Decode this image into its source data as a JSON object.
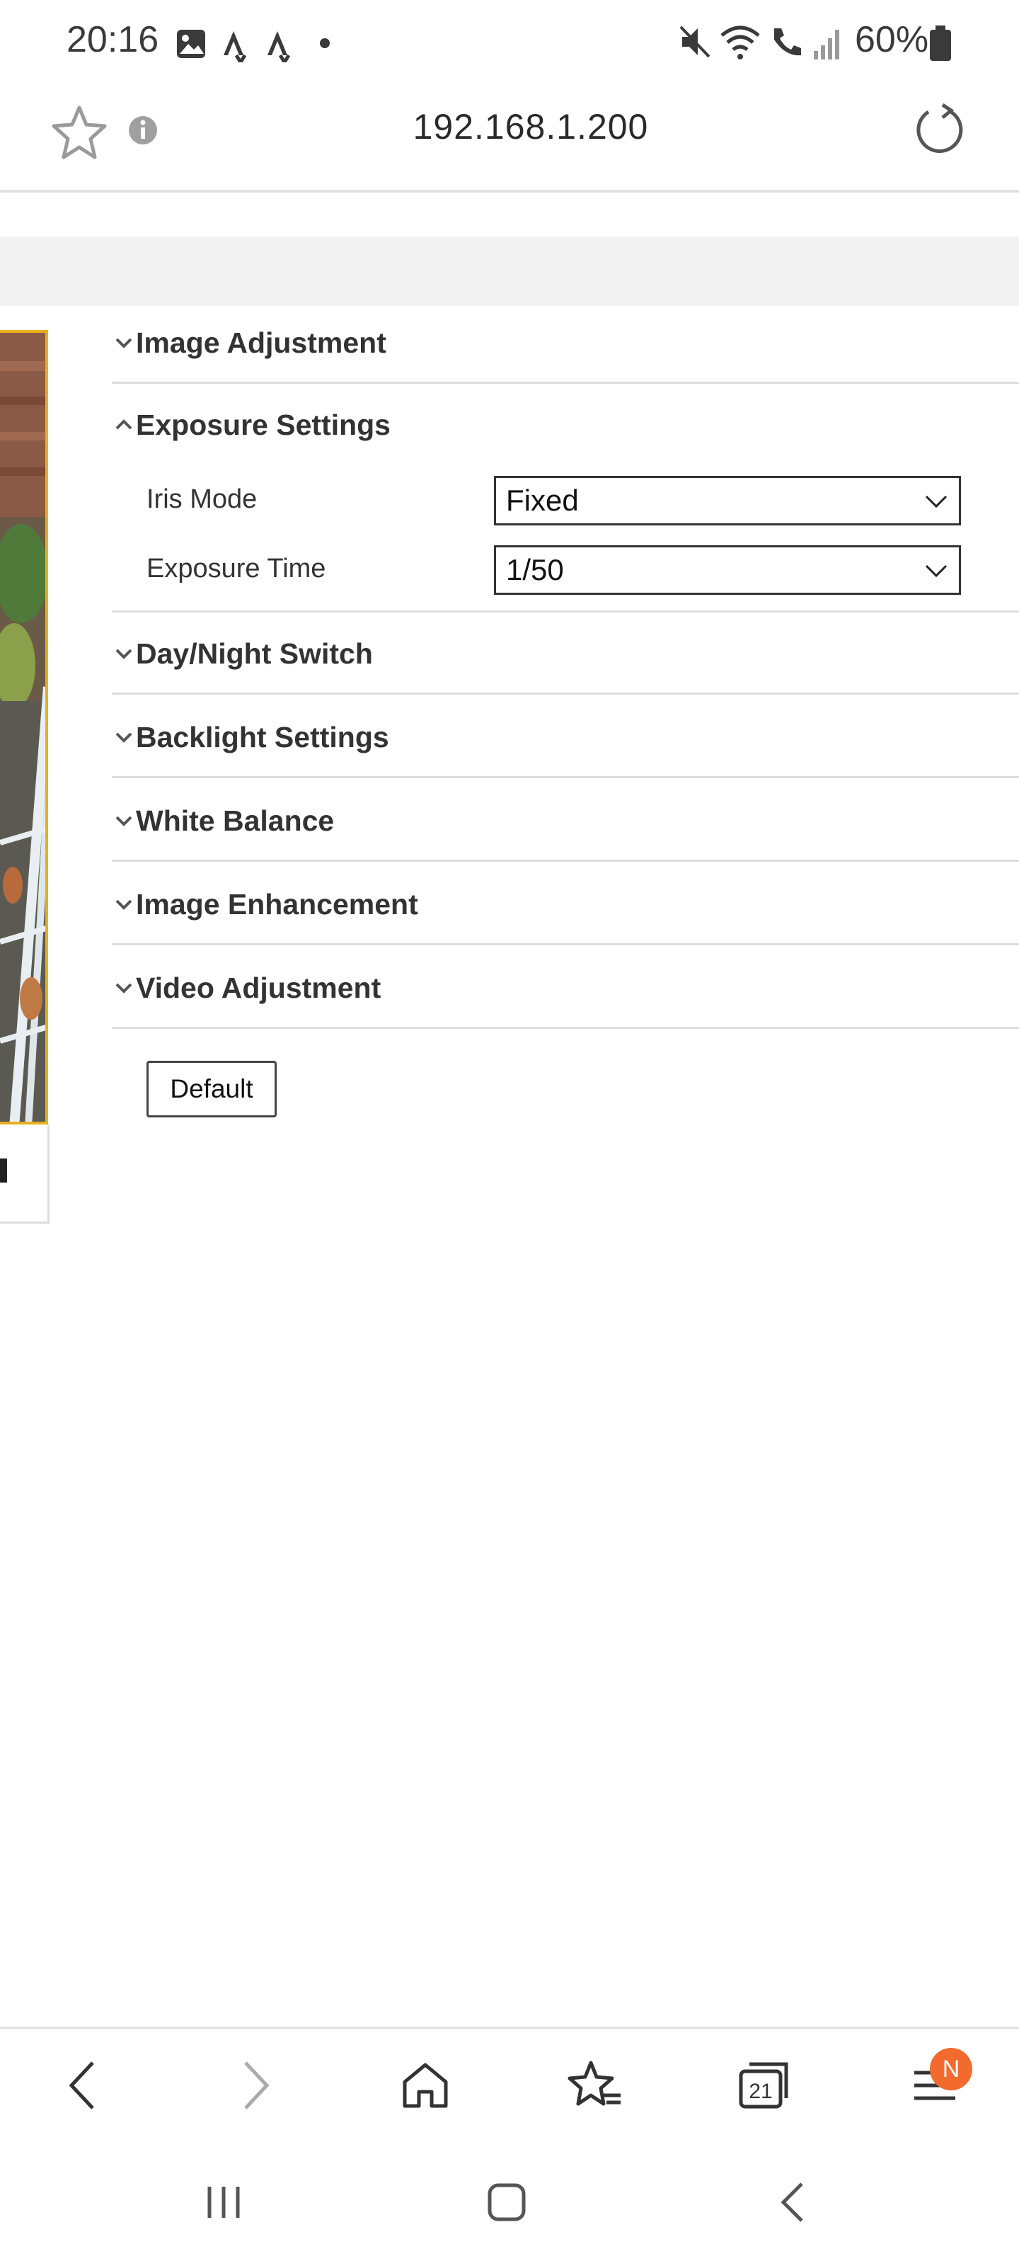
{
  "status_bar": {
    "time": "20:16",
    "battery": "60%",
    "left_icons": [
      "gallery-icon",
      "strava-icon",
      "strava-icon",
      "dot-icon"
    ],
    "right_icons": [
      "mute-icon",
      "wifi-icon",
      "wifi-call-icon",
      "signal-icon",
      "battery-icon"
    ]
  },
  "url_bar": {
    "url": "192.168.1.200"
  },
  "sections": {
    "image_adjustment": "Image Adjustment",
    "exposure_settings": "Exposure Settings",
    "day_night_switch": "Day/Night Switch",
    "backlight_settings": "Backlight Settings",
    "white_balance": "White Balance",
    "image_enhancement": "Image Enhancement",
    "video_adjustment": "Video Adjustment"
  },
  "exposure": {
    "iris_mode_label": "Iris Mode",
    "iris_mode_value": "Fixed",
    "exposure_time_label": "Exposure Time",
    "exposure_time_value": "1/50"
  },
  "default_button": "Default",
  "toolbar": {
    "tabs_count": "21",
    "notification_badge": "N"
  },
  "colors": {
    "accent_badge": "#f26a2e",
    "preview_border": "#e8b020"
  }
}
